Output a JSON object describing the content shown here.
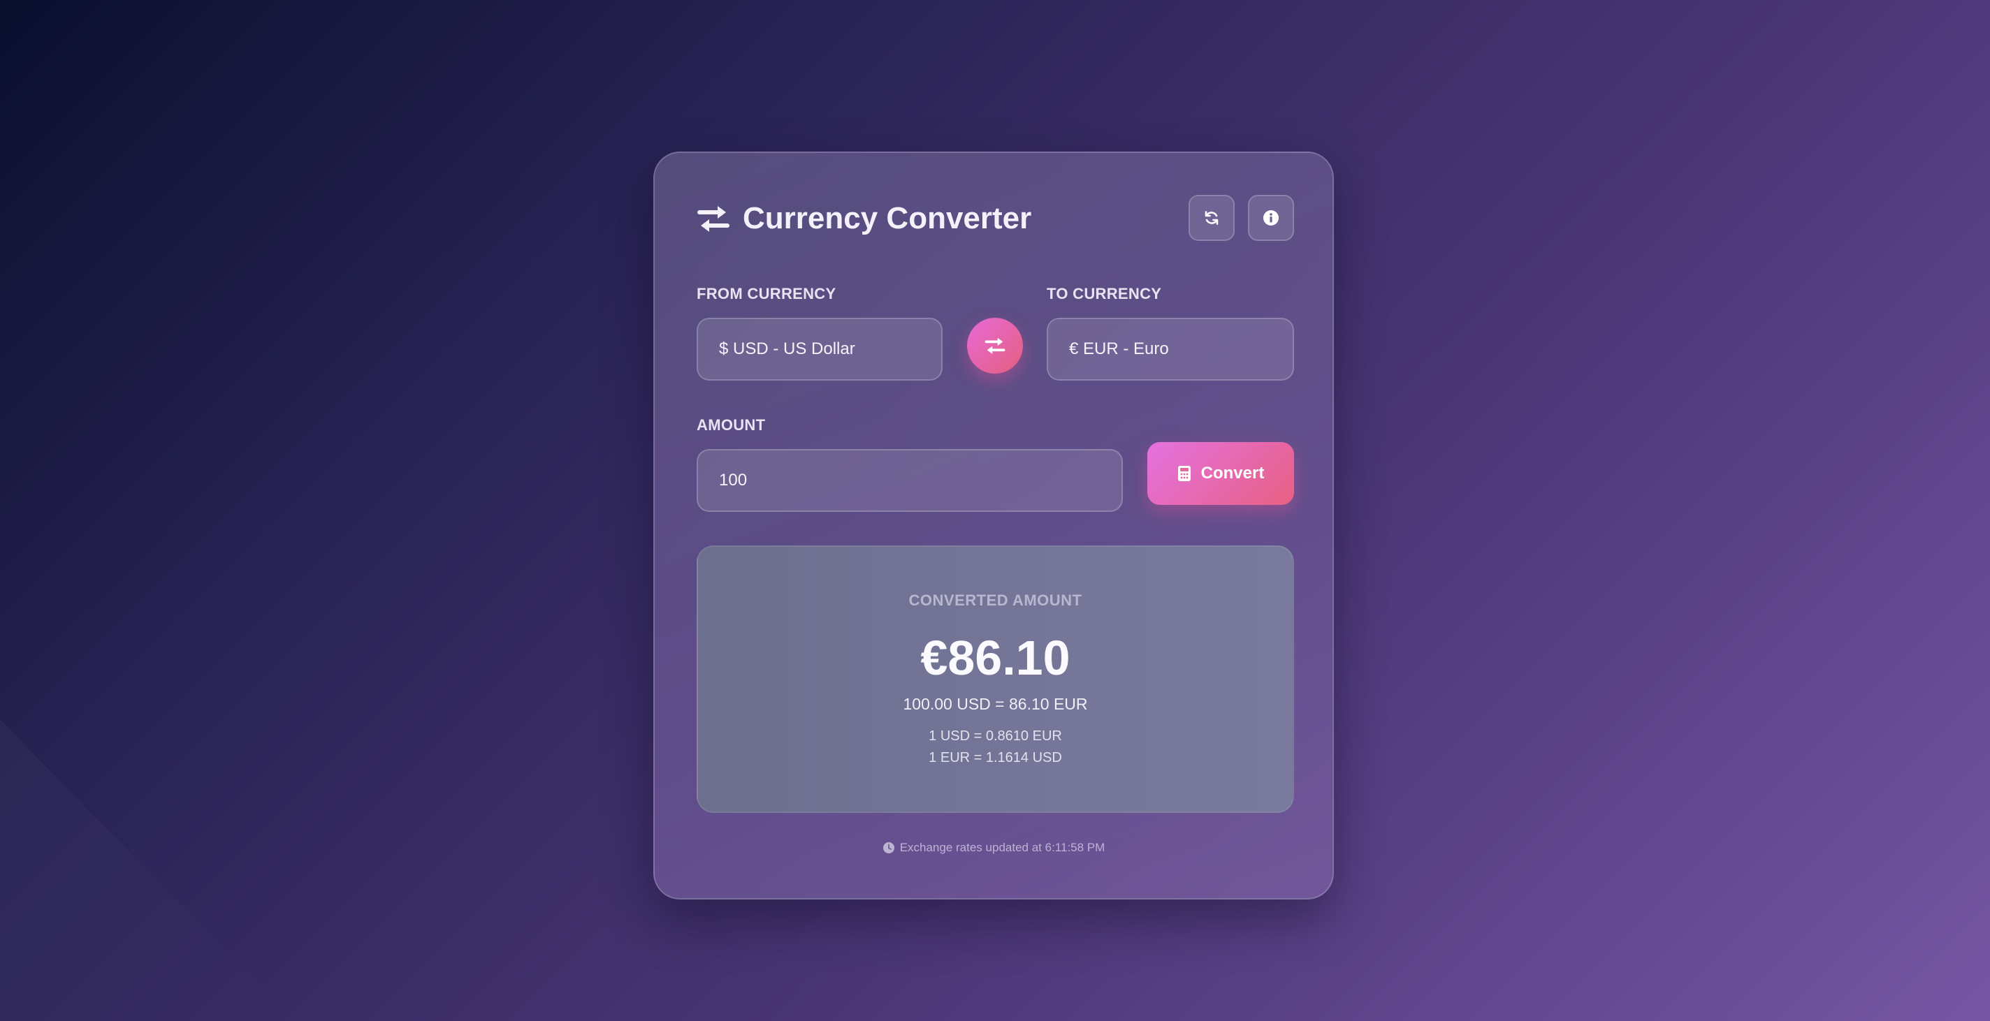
{
  "app": {
    "title": "Currency Converter",
    "icons": {
      "title": "exchange-arrows-icon",
      "refresh": "refresh-icon",
      "info": "info-icon",
      "swap": "swap-arrows-icon",
      "convert": "calculator-icon",
      "clock": "clock-icon"
    }
  },
  "from": {
    "label": "FROM CURRENCY",
    "value": "$ USD - US Dollar"
  },
  "to": {
    "label": "TO CURRENCY",
    "value": "€ EUR - Euro"
  },
  "amount": {
    "label": "AMOUNT",
    "value": "100"
  },
  "convert": {
    "label": "Convert"
  },
  "result": {
    "label": "CONVERTED AMOUNT",
    "amount": "€86.10",
    "equation": "100.00 USD = 86.10 EUR",
    "rate_forward": "1 USD = 0.8610 EUR",
    "rate_reverse": "1 EUR = 1.1614 USD"
  },
  "footer": {
    "text": "Exchange rates updated at 6:11:58 PM"
  },
  "colors": {
    "accent_start": "#e86ad8",
    "accent_end": "#e45f7e",
    "background_dark": "#0a0f2e",
    "background_light": "#7556a3"
  }
}
